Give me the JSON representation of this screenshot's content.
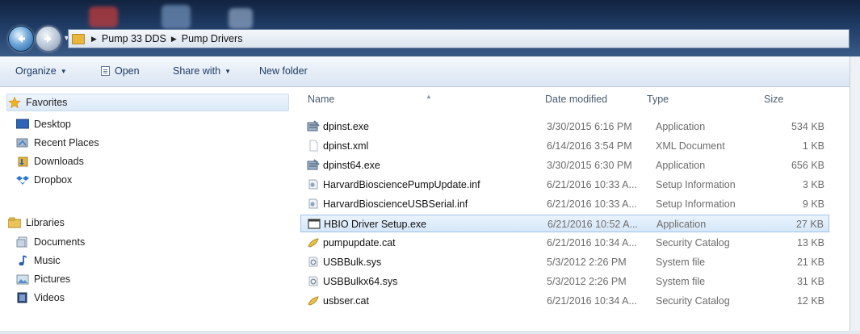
{
  "address_bar": {
    "crumbs": [
      "Pump 33 DDS",
      "Pump Drivers"
    ]
  },
  "toolbar": {
    "organize": "Organize",
    "open": "Open",
    "share_with": "Share with",
    "new_folder": "New folder"
  },
  "nav": {
    "favorites": "Favorites",
    "favorites_items": [
      "Desktop",
      "Recent Places",
      "Downloads",
      "Dropbox"
    ],
    "libraries": "Libraries",
    "libraries_items": [
      "Documents",
      "Music",
      "Pictures",
      "Videos"
    ]
  },
  "columns": {
    "name": "Name",
    "date": "Date modified",
    "type": "Type",
    "size": "Size"
  },
  "files": [
    {
      "name": "dpinst.exe",
      "date": "3/30/2015 6:16 PM",
      "type": "Application",
      "size": "534 KB",
      "icon": "installer-icon"
    },
    {
      "name": "dpinst.xml",
      "date": "6/14/2016 3:54 PM",
      "type": "XML Document",
      "size": "1 KB",
      "icon": "blank-file-icon"
    },
    {
      "name": "dpinst64.exe",
      "date": "3/30/2015 6:30 PM",
      "type": "Application",
      "size": "656 KB",
      "icon": "installer-icon"
    },
    {
      "name": "HarvardBiosciencePumpUpdate.inf",
      "date": "6/21/2016 10:33 A...",
      "type": "Setup Information",
      "size": "3 KB",
      "icon": "inf-file-icon"
    },
    {
      "name": "HarvardBioscienceUSBSerial.inf",
      "date": "6/21/2016 10:33 A...",
      "type": "Setup Information",
      "size": "9 KB",
      "icon": "inf-file-icon"
    },
    {
      "name": "HBIO Driver Setup.exe",
      "date": "6/21/2016 10:52 A...",
      "type": "Application",
      "size": "27 KB",
      "icon": "window-app-icon",
      "selected": true
    },
    {
      "name": "pumpupdate.cat",
      "date": "6/21/2016 10:34 A...",
      "type": "Security Catalog",
      "size": "13 KB",
      "icon": "catalog-icon"
    },
    {
      "name": "USBBulk.sys",
      "date": "5/3/2012 2:26 PM",
      "type": "System file",
      "size": "21 KB",
      "icon": "system-file-icon"
    },
    {
      "name": "USBBulkx64.sys",
      "date": "5/3/2012 2:26 PM",
      "type": "System file",
      "size": "31 KB",
      "icon": "system-file-icon"
    },
    {
      "name": "usbser.cat",
      "date": "6/21/2016 10:34 A...",
      "type": "Security Catalog",
      "size": "12 KB",
      "icon": "catalog-icon"
    }
  ],
  "colors": {
    "accent": "#1f3b64",
    "selection_border": "#9fc3e9",
    "selection_fill": "#d6e7f9"
  }
}
